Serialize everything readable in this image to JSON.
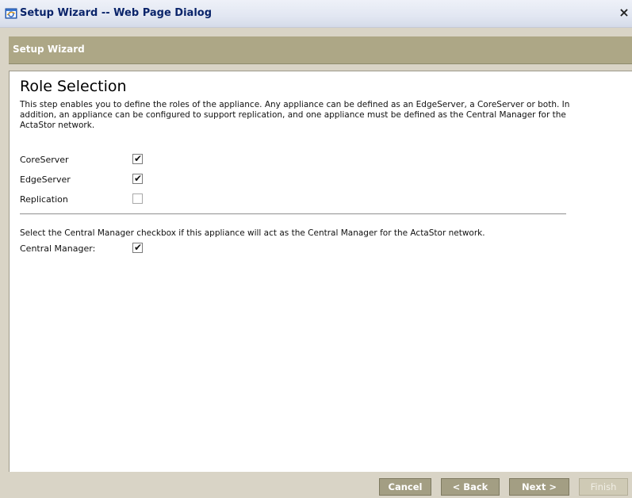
{
  "window": {
    "title": "Setup Wizard -- Web Page Dialog",
    "close_glyph": "×"
  },
  "header": {
    "title": "Setup Wizard"
  },
  "main": {
    "page_title": "Role Selection",
    "description": "This step enables you to define the roles of the appliance. Any appliance can be defined as an EdgeServer, a CoreServer or both. In addition, an appliance can be configured to support replication, and one appliance must be defined as the Central Manager for the ActaStor network.",
    "roles": [
      {
        "label": "CoreServer",
        "checked": true
      },
      {
        "label": "EdgeServer",
        "checked": true
      },
      {
        "label": "Replication",
        "checked": false
      }
    ],
    "central_manager_instruction": "Select the Central Manager checkbox if this appliance will act as the Central Manager for the ActaStor network.",
    "central_manager": {
      "label": "Central Manager:",
      "checked": true
    }
  },
  "footer": {
    "cancel_label": "Cancel",
    "back_label": "< Back",
    "next_label": "Next >",
    "finish_label": "Finish",
    "finish_enabled": false
  },
  "colors": {
    "header_band": "#ada786",
    "button": "#a39e83",
    "title_text": "#0a246a"
  },
  "icons": {
    "app_icon": "ie-window-icon",
    "checkbox_tick": "✔"
  }
}
